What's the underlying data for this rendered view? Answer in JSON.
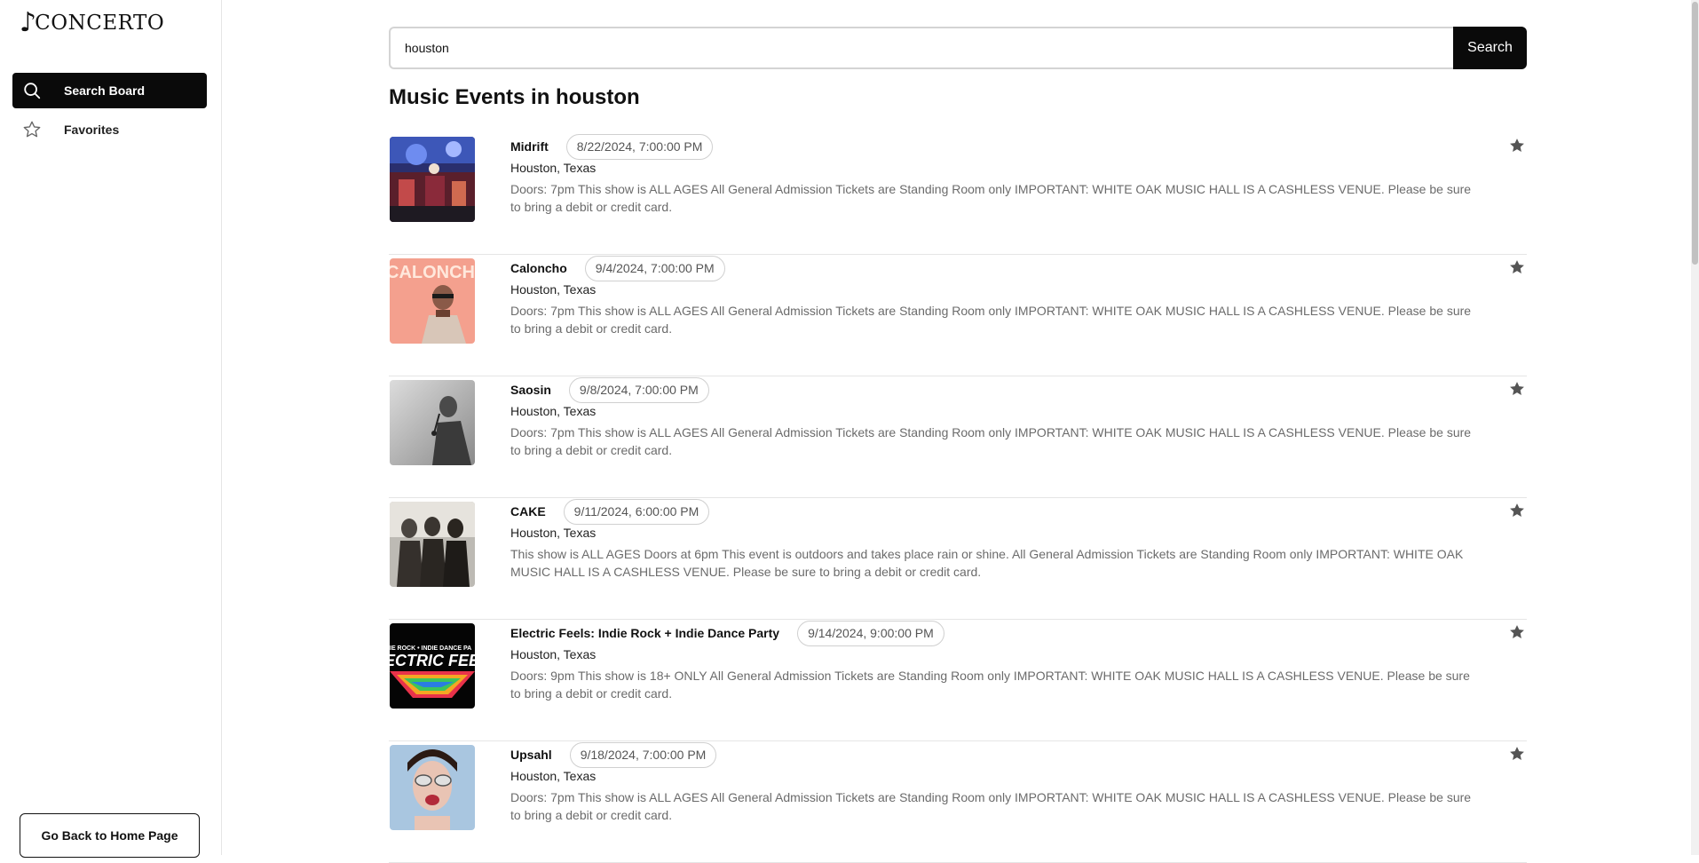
{
  "app": {
    "logo_note": "♪",
    "logo_text": "CONCERTO"
  },
  "sidebar": {
    "items": [
      {
        "label": "Search Board",
        "icon": "search-icon",
        "active": true
      },
      {
        "label": "Favorites",
        "icon": "star-outline-icon",
        "active": false
      }
    ],
    "home_button": "Go Back to Home Page"
  },
  "search": {
    "value": "houston",
    "button_label": "Search"
  },
  "page": {
    "title": "Music Events in houston"
  },
  "events": [
    {
      "name": "Midrift",
      "date": "8/22/2024, 7:00:00 PM",
      "location": "Houston, Texas",
      "description": "Doors: 7pm This show is ALL AGES All General Admission Tickets are Standing Room only IMPORTANT: WHITE OAK MUSIC HALL IS A CASHLESS VENUE. Please be sure to bring a debit or credit card."
    },
    {
      "name": "Caloncho",
      "date": "9/4/2024, 7:00:00 PM",
      "location": "Houston, Texas",
      "description": "Doors: 7pm This show is ALL AGES All General Admission Tickets are Standing Room only IMPORTANT: WHITE OAK MUSIC HALL IS A CASHLESS VENUE. Please be sure to bring a debit or credit card."
    },
    {
      "name": "Saosin",
      "date": "9/8/2024, 7:00:00 PM",
      "location": "Houston, Texas",
      "description": "Doors: 7pm This show is ALL AGES All General Admission Tickets are Standing Room only IMPORTANT: WHITE OAK MUSIC HALL IS A CASHLESS VENUE. Please be sure to bring a debit or credit card."
    },
    {
      "name": "CAKE",
      "date": "9/11/2024, 6:00:00 PM",
      "location": "Houston, Texas",
      "description": "This show is ALL AGES Doors at 6pm This event is outdoors and takes place rain or shine. All General Admission Tickets are Standing Room only IMPORTANT: WHITE OAK MUSIC HALL IS A CASHLESS VENUE. Please be sure to bring a debit or credit card."
    },
    {
      "name": "Electric Feels: Indie Rock + Indie Dance Party",
      "date": "9/14/2024, 9:00:00 PM",
      "location": "Houston, Texas",
      "description": "Doors: 9pm This show is 18+ ONLY All General Admission Tickets are Standing Room only IMPORTANT: WHITE OAK MUSIC HALL IS A CASHLESS VENUE. Please be sure to bring a debit or credit card."
    },
    {
      "name": "Upsahl",
      "date": "9/18/2024, 7:00:00 PM",
      "location": "Houston, Texas",
      "description": "Doors: 7pm This show is ALL AGES All General Admission Tickets are Standing Room only IMPORTANT: WHITE OAK MUSIC HALL IS A CASHLESS VENUE. Please be sure to bring a debit or credit card."
    }
  ],
  "thumb_banner": {
    "caloncho": "CALONCHO",
    "electric_top": "IE ROCK • INDIE DANCE PA",
    "electric_main": "ECTRIC FEEL"
  },
  "colors": {
    "accent": "#0a0a0a",
    "star": "#555555",
    "muted_text": "#6b6b6b",
    "border": "#e5e5e5"
  }
}
